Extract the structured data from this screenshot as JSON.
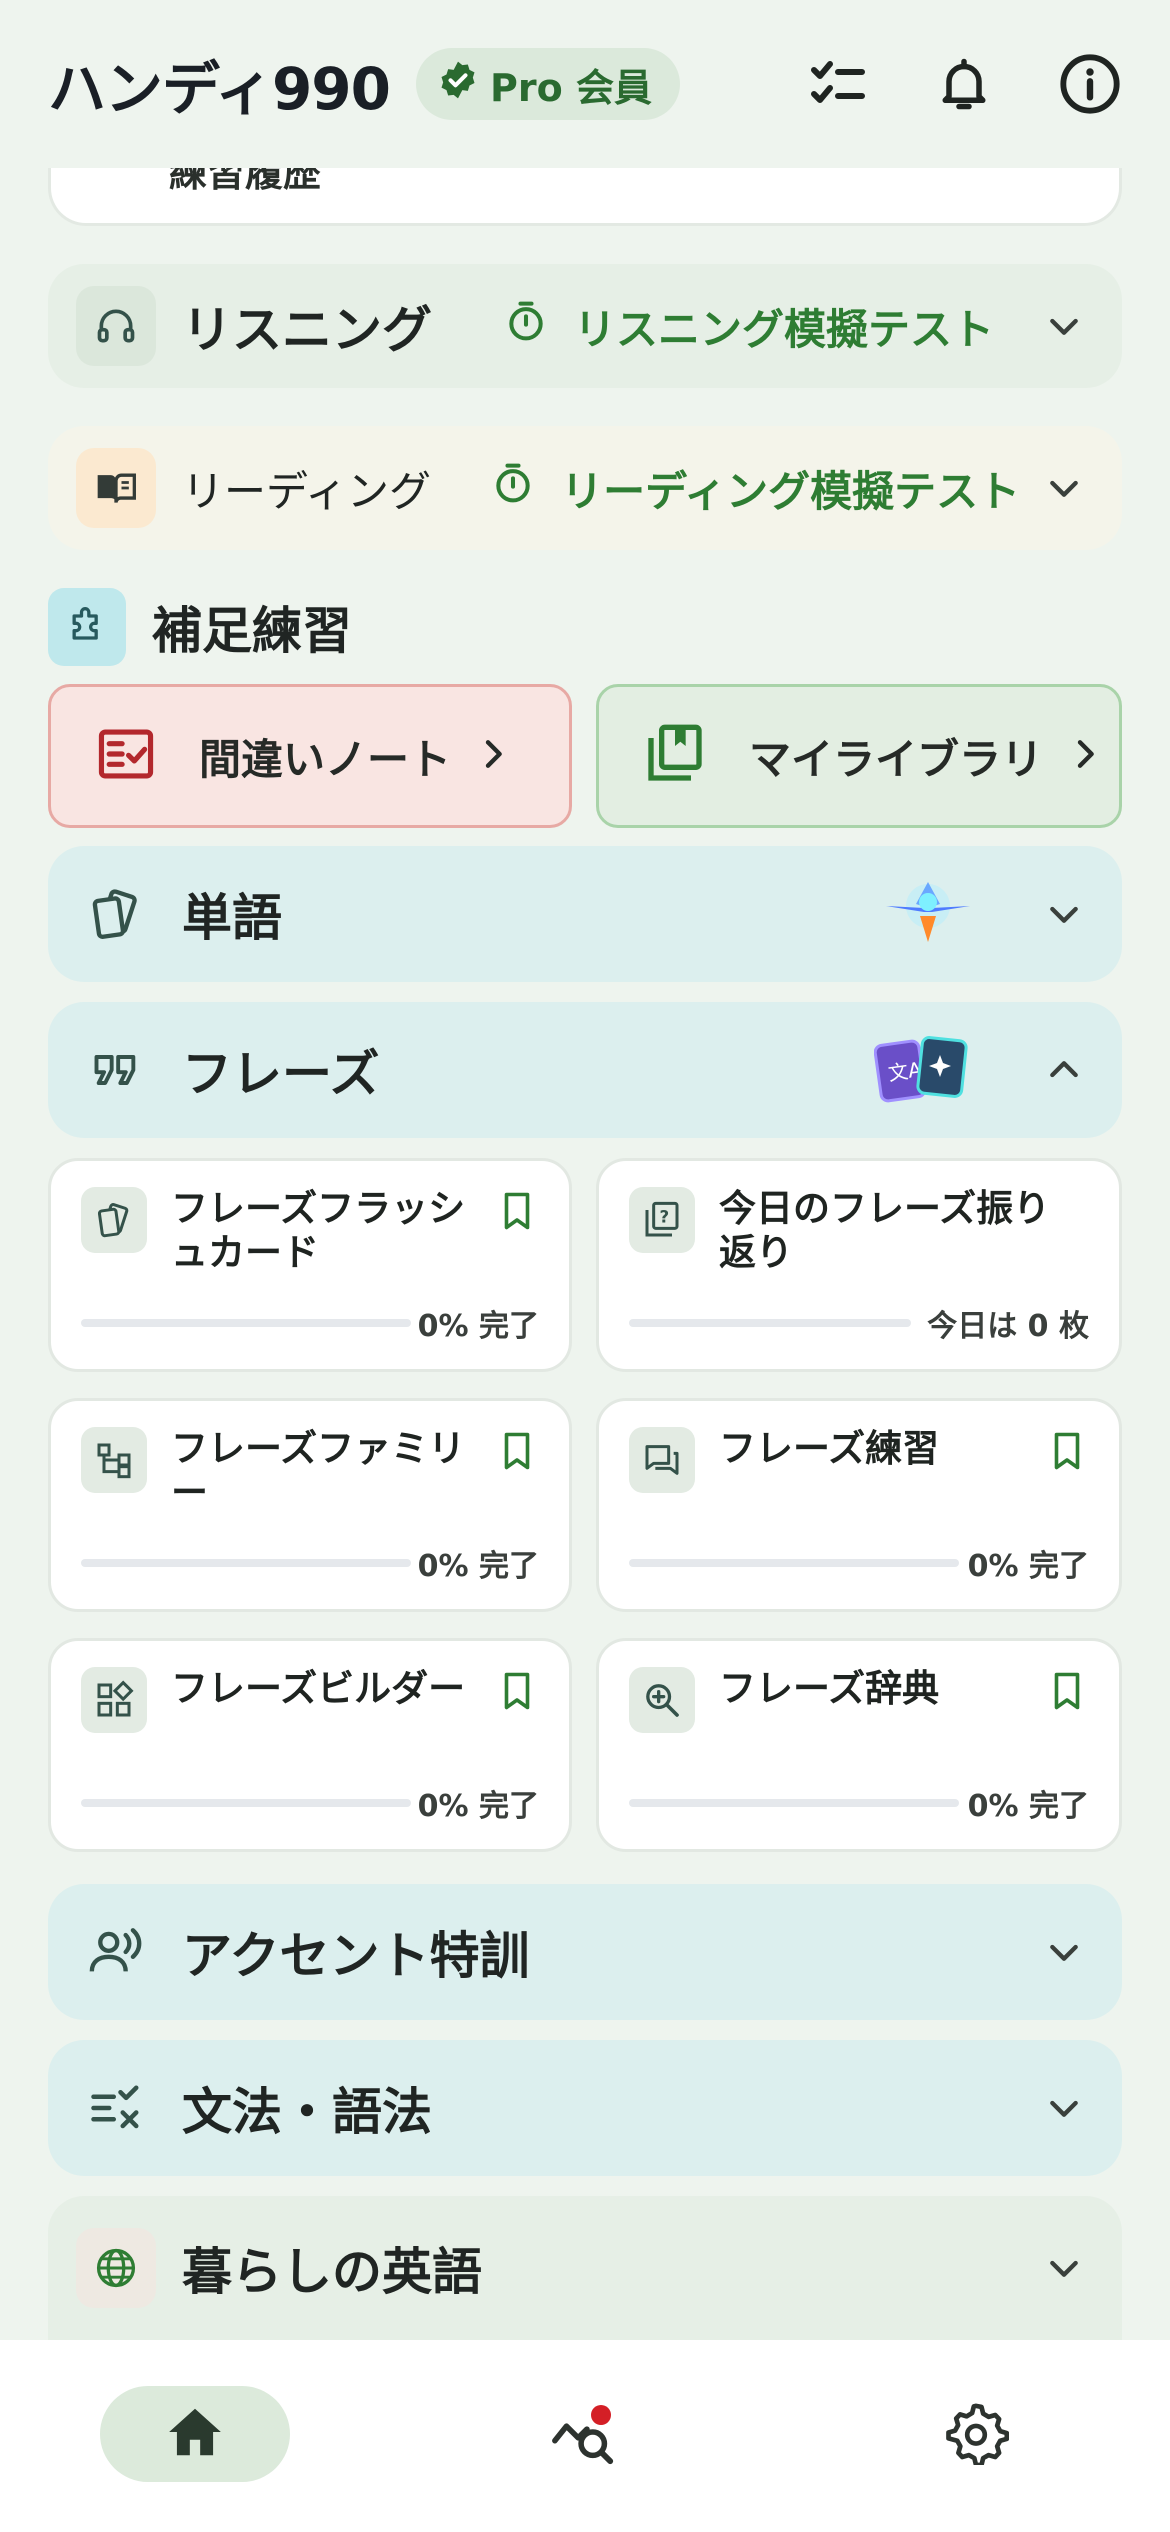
{
  "header": {
    "app_title": "ハンディ990",
    "badge_label": "Pro 会員",
    "icons": [
      "verified-icon",
      "checklist-icon",
      "bell-icon",
      "info-icon"
    ]
  },
  "partial_row": {
    "label": "練習履歴"
  },
  "listening": {
    "title": "リスニング",
    "mock_test": "リスニング模擬テスト"
  },
  "reading": {
    "title": "リーディング",
    "mock_test": "リーディング模擬テスト"
  },
  "supplementary": {
    "title": "補足練習",
    "mistake_notes": "間違いノート",
    "my_library": "マイライブラリ"
  },
  "sections": {
    "vocab": "単語",
    "phrases": "フレーズ",
    "accent": "アクセント特訓",
    "grammar": "文法・語法",
    "daily": "暮らしの英語"
  },
  "phrase_cards": [
    {
      "title": "フレーズフラッシュカード",
      "status": "0% 完了",
      "progress": 0
    },
    {
      "title": "今日のフレーズ振り返り",
      "status": "今日は 0 枚",
      "progress": 0
    },
    {
      "title": "フレーズファミリー",
      "status": "0% 完了",
      "progress": 0
    },
    {
      "title": "フレーズ練習",
      "status": "0% 完了",
      "progress": 0
    },
    {
      "title": "フレーズビルダー",
      "status": "0% 完了",
      "progress": 0
    },
    {
      "title": "フレーズ辞典",
      "status": "0% 完了",
      "progress": 0
    }
  ],
  "colors": {
    "accent_green": "#2e7d33",
    "background": "#eef4ee",
    "notification_dot": "#d41f26"
  },
  "nav": {
    "items": [
      "home-icon",
      "stats-search-icon",
      "settings-icon"
    ],
    "active": "home"
  }
}
